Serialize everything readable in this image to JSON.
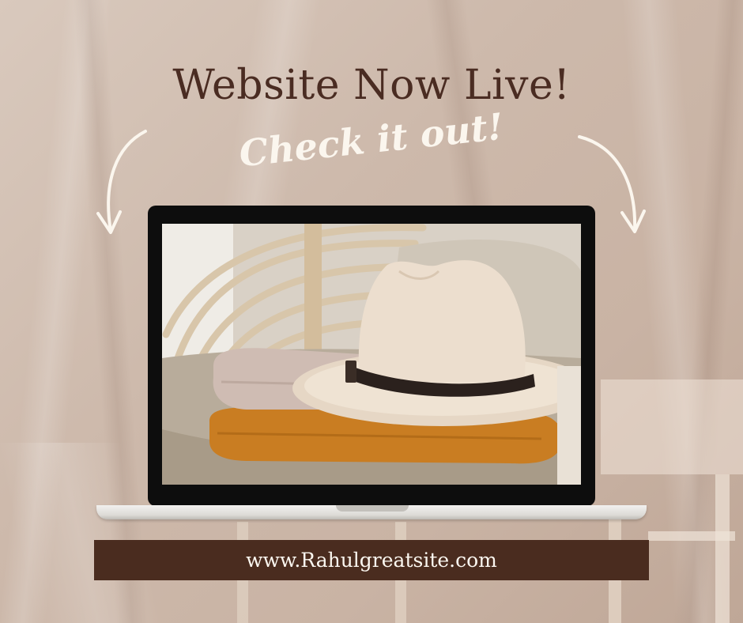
{
  "headline": "Website Now Live!",
  "subheadline": "Check it out!",
  "url": "www.Rahulgreatsite.com",
  "colors": {
    "background": "#d4c2b5",
    "headline": "#4a2c22",
    "subheadline": "#fbf6ee",
    "url_bar": "#4a2c1f",
    "url_text": "#fbf7f0",
    "laptop_bezel": "#0d0d0d"
  },
  "icons": [
    "curved-arrow-left-icon",
    "curved-arrow-right-icon"
  ]
}
